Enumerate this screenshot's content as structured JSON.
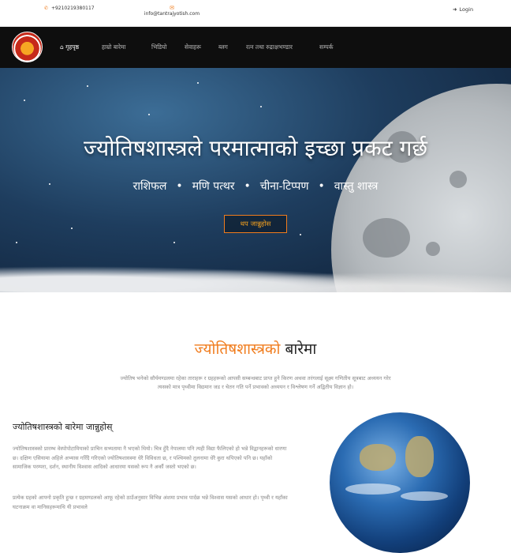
{
  "topbar": {
    "phone_icon": "phone-icon",
    "phone": "+9210219380117",
    "email_icon": "envelope-icon",
    "email": "info@tantrajyotish.com",
    "login_icon": "sign-in-icon",
    "login": "Login"
  },
  "navbar": {
    "logo_icon": "tantra-jyotish-logo",
    "home_icon": "home-icon",
    "items": [
      {
        "label": "गृहपृष्ठ"
      },
      {
        "label": "हाम्रो बारेमा"
      },
      {
        "label": "भिडियो"
      },
      {
        "label": "सेवाहरू"
      },
      {
        "label": "ब्लग"
      },
      {
        "label": "रत्न तथा रुद्राक्षभण्डार"
      },
      {
        "label": "सम्पर्क"
      }
    ]
  },
  "hero": {
    "title": "ज्योतिषशास्त्रले परमात्माको इच्छा प्रकट गर्छ",
    "services": [
      "राशिफल",
      "मणि पत्थर",
      "चीना-टिप्पण",
      "वास्तु शास्त्र"
    ],
    "bullet": "•",
    "button": "थप जान्नुहोस"
  },
  "about": {
    "title_highlight": "ज्योतिषशास्त्रको",
    "title_rest": "बारेमा",
    "intro": "ज्योतिष भनेको सौर्यमण्डलमा रहेका ताराहरू र ग्रहहरूको आपसी सम्बन्धबाट प्राप्त हुने किरण अथवा तरंगलाई सूक्ष्म गणितीय सूत्रबाट अध्ययन गरेर त्यसको मात्र पृथ्वीमा विद्यमान जड र चेतन गति पर्ने प्रभावको अध्ययन र विश्लेषण गर्ने अद्वितीय विज्ञान हो।",
    "know_title": "ज्योतिषशास्त्रको बारेमा जान्नुहोस्",
    "para1": "ज्योतिषशास्त्रको प्रारम्भ वेस्पोपोटामियाको प्राचिन सभ्यतामा नै भएको थियो। चित्र हुँदै नेपालमा पनि त्यही विद्या फैलिएको हो भन्ने विद्वानहरूको धारणा छ। दक्षिण एसियामा अहिले अभ्यास गरिँदै गरिएको ज्योतिषशास्त्रमा धेरै विविधता छ, र पश्चिमको तुलनामा धेरै कुरा थपिएको पनि छ। यहाँको सामाजिक परम्परा, दर्शन, स्थानीय विश्वास आदिको आधारमा यसको रूप नै अर्कौ जस्तो भएको छ।",
    "para2": "प्रत्येक ग्रहको आफ्नो प्रकृति हुन्छ र ग्रहमण्डलको आफू रहेको ठाउँअनुसार विभिन्न अंशमा प्रभाव पार्दछ भन्ने विश्वास यसको आधार हो। पृथ्वी र यहाँका घटनाक्रम वा मानिसहरूमाथि यी प्रभावले",
    "earth_icon": "earth-globe-image"
  }
}
